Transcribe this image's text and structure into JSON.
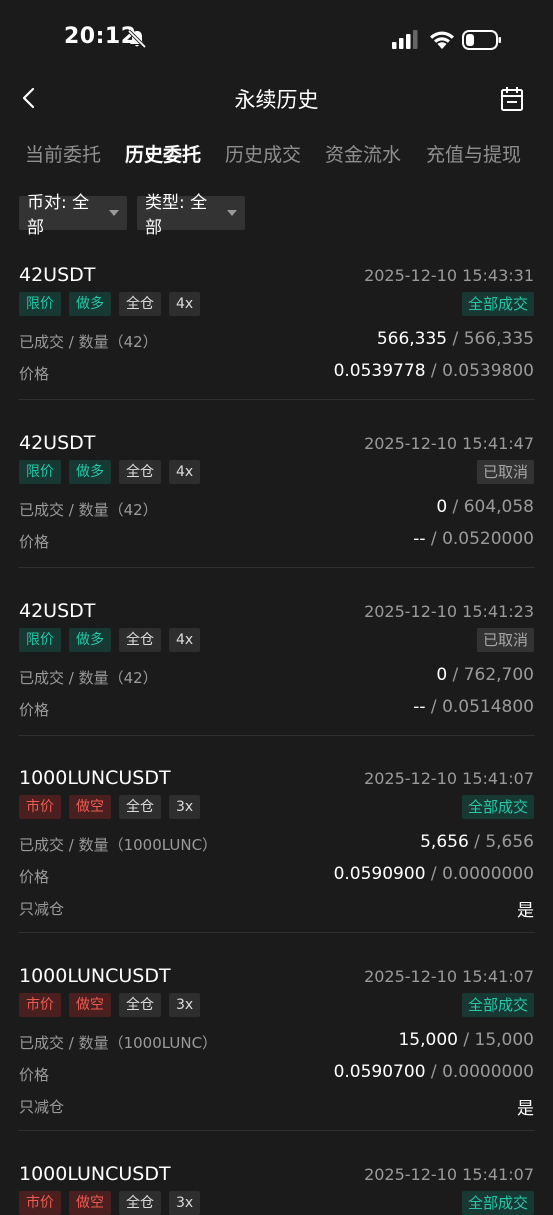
{
  "status_bar": {
    "time": "20:12"
  },
  "header": {
    "title": "永续历史"
  },
  "tabs": [
    {
      "label": "当前委托"
    },
    {
      "label": "历史委托"
    },
    {
      "label": "历史成交"
    },
    {
      "label": "资金流水"
    },
    {
      "label": "充值与提现"
    }
  ],
  "filters": {
    "pair": "币对: 全部",
    "type": "类型: 全部"
  },
  "labels": {
    "filled_qty": "已成交 / 数量",
    "price": "价格",
    "reduce_only": "只减仓",
    "sep": " / "
  },
  "orders": [
    {
      "symbol": "42USDT",
      "time": "2025-12-10 15:43:31",
      "order_type": "限价",
      "side": "做多",
      "margin": "全仓",
      "leverage": "4x",
      "status": "全部成交",
      "unit": "（42）",
      "filled": "566,335",
      "quantity": "566,335",
      "avg_price": "0.0539778",
      "order_price": "0.0539800"
    },
    {
      "symbol": "42USDT",
      "time": "2025-12-10 15:41:47",
      "order_type": "限价",
      "side": "做多",
      "margin": "全仓",
      "leverage": "4x",
      "status": "已取消",
      "unit": "（42）",
      "filled": "0",
      "quantity": "604,058",
      "avg_price": "--",
      "order_price": "0.0520000"
    },
    {
      "symbol": "42USDT",
      "time": "2025-12-10 15:41:23",
      "order_type": "限价",
      "side": "做多",
      "margin": "全仓",
      "leverage": "4x",
      "status": "已取消",
      "unit": "（42）",
      "filled": "0",
      "quantity": "762,700",
      "avg_price": "--",
      "order_price": "0.0514800"
    },
    {
      "symbol": "1000LUNCUSDT",
      "time": "2025-12-10 15:41:07",
      "order_type": "市价",
      "side": "做空",
      "margin": "全仓",
      "leverage": "3x",
      "status": "全部成交",
      "unit": "（1000LUNC）",
      "filled": "5,656",
      "quantity": "5,656",
      "avg_price": "0.0590900",
      "order_price": "0.0000000",
      "reduce_only": "是"
    },
    {
      "symbol": "1000LUNCUSDT",
      "time": "2025-12-10 15:41:07",
      "order_type": "市价",
      "side": "做空",
      "margin": "全仓",
      "leverage": "3x",
      "status": "全部成交",
      "unit": "（1000LUNC）",
      "filled": "15,000",
      "quantity": "15,000",
      "avg_price": "0.0590700",
      "order_price": "0.0000000",
      "reduce_only": "是"
    },
    {
      "symbol": "1000LUNCUSDT",
      "time": "2025-12-10 15:41:07",
      "order_type": "市价",
      "side": "做空",
      "margin": "全仓",
      "leverage": "3x",
      "status": "全部成交"
    }
  ],
  "colors": {
    "background": "#1b1b1b",
    "buy_green": "#27c7a8",
    "sell_red": "#ee5b52",
    "muted_text": "#9a9a9a"
  },
  "icons": [
    "back-arrow-icon",
    "calendar-icon",
    "bell-off-icon",
    "signal-icon",
    "wifi-icon",
    "battery-icon",
    "caret-down-icon"
  ]
}
